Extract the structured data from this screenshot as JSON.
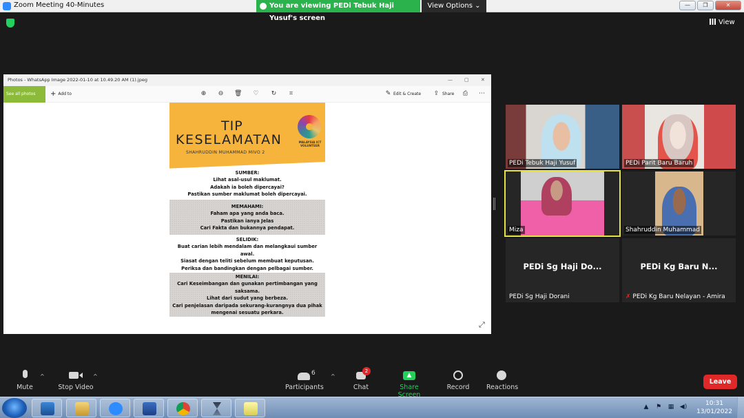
{
  "window": {
    "title": "Zoom Meeting 40-Minutes",
    "share_banner": "You are viewing PEDi Tebuk Haji Yusuf's screen",
    "view_options": "View Options ⌄",
    "view_label": "View"
  },
  "photos": {
    "title": "Photos - WhatsApp Image 2022-01-10 at 10.49.20 AM (1).jpeg",
    "see_all": "See all photos",
    "add_to": "Add to",
    "edit_create": "Edit & Create",
    "share": "Share"
  },
  "poster": {
    "title_line1": "TIP",
    "title_line2": "KESELAMATAN",
    "subtitle": "SHAHRUDDIN MUHAMMAD MIVO 2",
    "logo_text": "MALAYSIA ICT VOLUNTEER",
    "sections": [
      {
        "heading": "SUMBER:",
        "lines": [
          "Lihat asal-usul maklumat.",
          "Adakah ia boleh dipercayai?",
          "Pastikan sumber maklumat boleh dipercayai."
        ]
      },
      {
        "heading": "MEMAHAMI:",
        "lines": [
          "Faham apa yang anda baca.",
          "Pastikan ianya Jelas",
          "Cari Fakta dan bukannya pendapat."
        ]
      },
      {
        "heading": "SELIDIK:",
        "lines": [
          "Buat carian lebih mendalam dan melangkaui sumber",
          "awal.",
          "Siasat dengan teliti sebelum membuat keputusan.",
          "Periksa dan bandingkan dengan pelbagai sumber."
        ]
      },
      {
        "heading": "MENILAI:",
        "lines": [
          "Cari Keseimbangan dan gunakan pertimbangan yang",
          "saksama.",
          "Lihat dari sudut yang berbeza.",
          "Cari penjelasan daripada sekurang-kurangnya dua pihak",
          "mengenai sesuatu perkara."
        ]
      }
    ]
  },
  "participants_tiles": [
    {
      "name": "PEDi Tebuk Haji Yusuf",
      "video": true
    },
    {
      "name": "PEDi Parit Baru Baruh",
      "video": true
    },
    {
      "name": "Miza",
      "video": true,
      "active": true
    },
    {
      "name": "Shahruddin Muhammad",
      "video": true
    },
    {
      "name": "PEDi Sg Haji Dorani",
      "display": "PEDi Sg Haji Do...",
      "video": false
    },
    {
      "name": "PEDi Kg Baru Nelayan - Amira",
      "display": "PEDi Kg Baru N...",
      "video": false,
      "muted": true
    }
  ],
  "controls": {
    "mute": "Mute",
    "stop_video": "Stop Video",
    "participants": "Participants",
    "participants_count": "6",
    "chat": "Chat",
    "chat_badge": "2",
    "share_screen": "Share Screen",
    "record": "Record",
    "reactions": "Reactions",
    "leave": "Leave"
  },
  "taskbar": {
    "time": "10:31",
    "date": "13/01/2022"
  },
  "colors": {
    "zoom_blue": "#2d8cff",
    "share_green": "#2bb24c",
    "leave_red": "#e02828",
    "active_speaker": "#e7e244",
    "poster_orange": "#f7b43c"
  }
}
